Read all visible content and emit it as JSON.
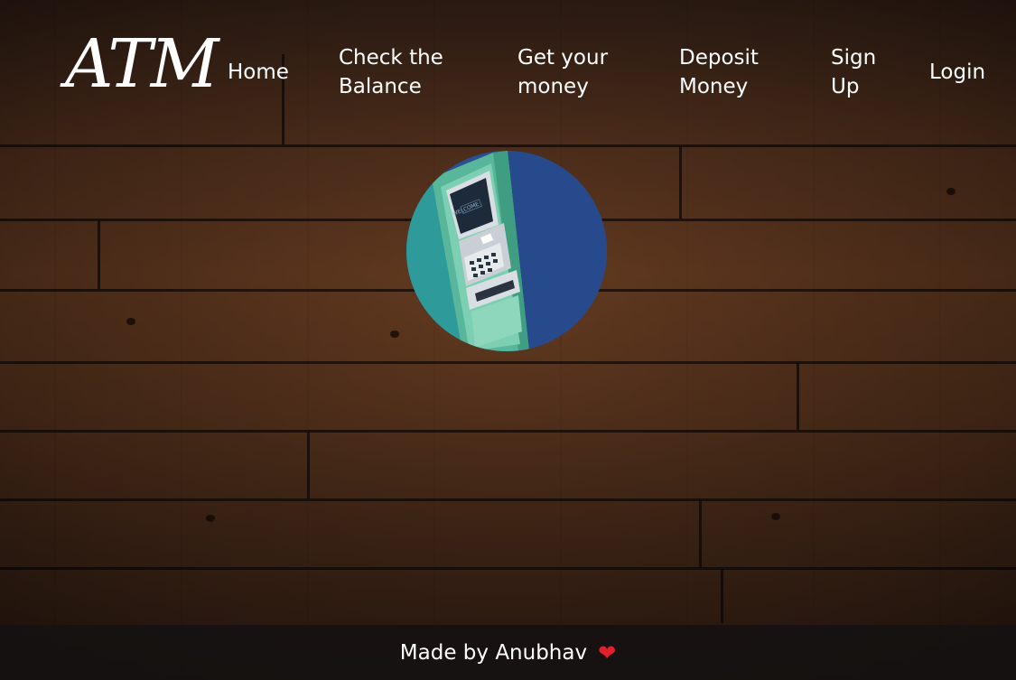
{
  "logo": {
    "text": "ATM"
  },
  "nav": {
    "home": "Home",
    "check_balance_line1": "Check the",
    "check_balance_line2": "Balance",
    "get_money_line1": "Get your",
    "get_money_line2": "money",
    "deposit_line1": "Deposit",
    "deposit_line2": "Money",
    "signup_line1": "Sign",
    "signup_line2": "Up",
    "login": "Login"
  },
  "hero": {
    "atm_screen_text": "WELCOME"
  },
  "footer": {
    "text": "Made by Anubhav",
    "heart_icon": "heart-icon"
  },
  "colors": {
    "text": "#ffffff",
    "footer_bg": "#141212",
    "heart": "#e0202b",
    "circle_bg": "#2b4f93"
  }
}
